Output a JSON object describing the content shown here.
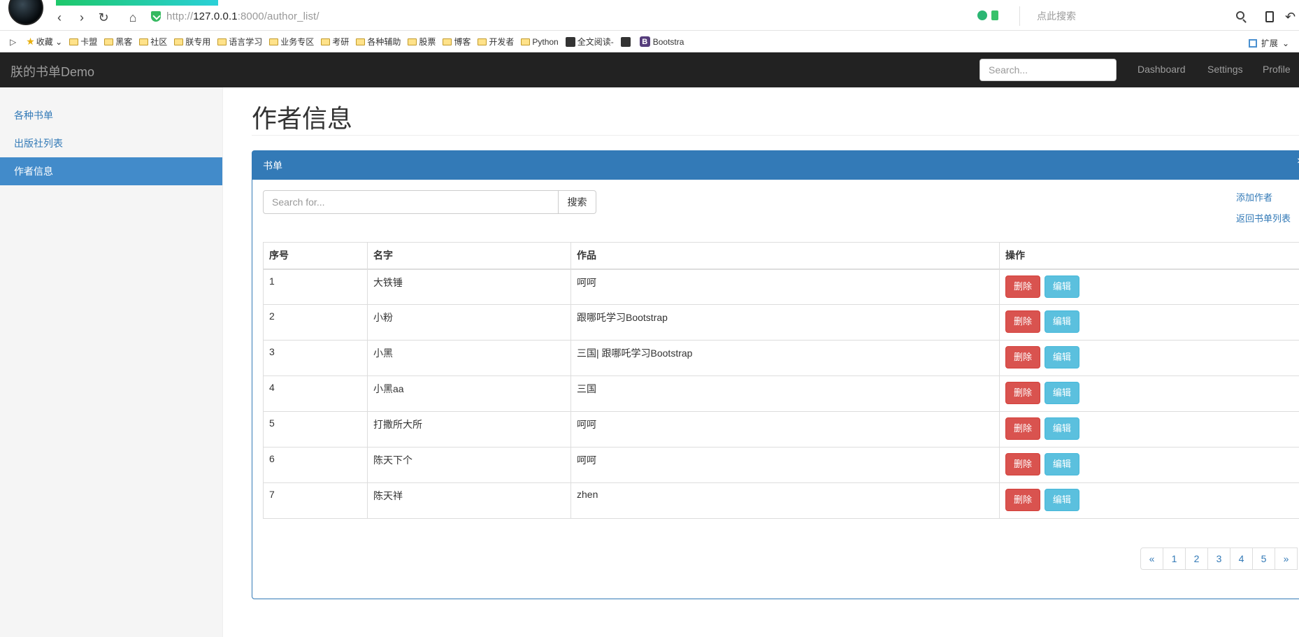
{
  "browser": {
    "url_prefix": "http://",
    "url_host": "127.0.0.1",
    "url_rest": ":8000/author_list/",
    "search_placeholder": "点此搜索",
    "bookmarks": [
      "收藏",
      "卡盟",
      "黑客",
      "社区",
      "朕专用",
      "语言学习",
      "业务专区",
      "考研",
      "各种辅助",
      "股票",
      "博客",
      "开发者",
      "Python",
      "全文阅读-",
      "Bootstra"
    ],
    "extensions_label": "扩展"
  },
  "navbar": {
    "brand": "朕的书单Demo",
    "search_placeholder": "Search...",
    "links": [
      "Dashboard",
      "Settings",
      "Profile"
    ]
  },
  "sidebar": {
    "items": [
      {
        "label": "各种书单"
      },
      {
        "label": "出版社列表"
      },
      {
        "label": "作者信息"
      }
    ]
  },
  "main": {
    "title": "作者信息",
    "panel_title": "书单",
    "search_placeholder": "Search for...",
    "search_button": "搜索",
    "add_author": "添加作者",
    "back_to_list": "返回书单列表",
    "table": {
      "headers": [
        "序号",
        "名字",
        "作品",
        "操作"
      ],
      "rows": [
        {
          "id": "1",
          "name": "大铁锤",
          "works": "呵呵"
        },
        {
          "id": "2",
          "name": "小粉",
          "works": "跟哪吒学习Bootstrap"
        },
        {
          "id": "3",
          "name": "小黑",
          "works": "三国| 跟哪吒学习Bootstrap"
        },
        {
          "id": "4",
          "name": "小黑aa",
          "works": "三国"
        },
        {
          "id": "5",
          "name": "打撒所大所",
          "works": "呵呵"
        },
        {
          "id": "6",
          "name": "陈天下个",
          "works": "呵呵"
        },
        {
          "id": "7",
          "name": "陈天祥",
          "works": "zhen"
        }
      ],
      "delete_label": "删除",
      "edit_label": "编辑"
    },
    "pagination": [
      "«",
      "1",
      "2",
      "3",
      "4",
      "5",
      "»"
    ]
  },
  "colors": {
    "primary": "#337ab7",
    "navbar_bg": "#222222",
    "danger": "#d9534f",
    "info": "#5bc0de",
    "sidebar_active": "#428bca"
  }
}
